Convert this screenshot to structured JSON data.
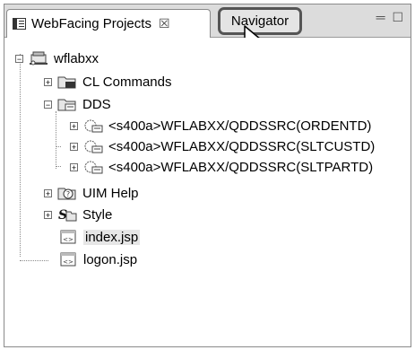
{
  "tabs": {
    "webfacing_label": "WebFacing Projects",
    "webfacing_close": "☒",
    "navigator_label": "Navigator",
    "view_controls": "═ ☐"
  },
  "tree": {
    "project": "wflabxx",
    "cl_commands": "CL Commands",
    "dds": "DDS",
    "dds_members": [
      "<s400a>WFLABXX/QDDSSRC(ORDENTD)",
      "<s400a>WFLABXX/QDDSSRC(SLTCUSTD)",
      "<s400a>WFLABXX/QDDSSRC(SLTPARTD)"
    ],
    "uim_help": "UIM Help",
    "style": "Style",
    "files": [
      "index.jsp",
      "logon.jsp"
    ]
  },
  "expander_symbols": {
    "collapsed": "+",
    "expanded": "−"
  }
}
